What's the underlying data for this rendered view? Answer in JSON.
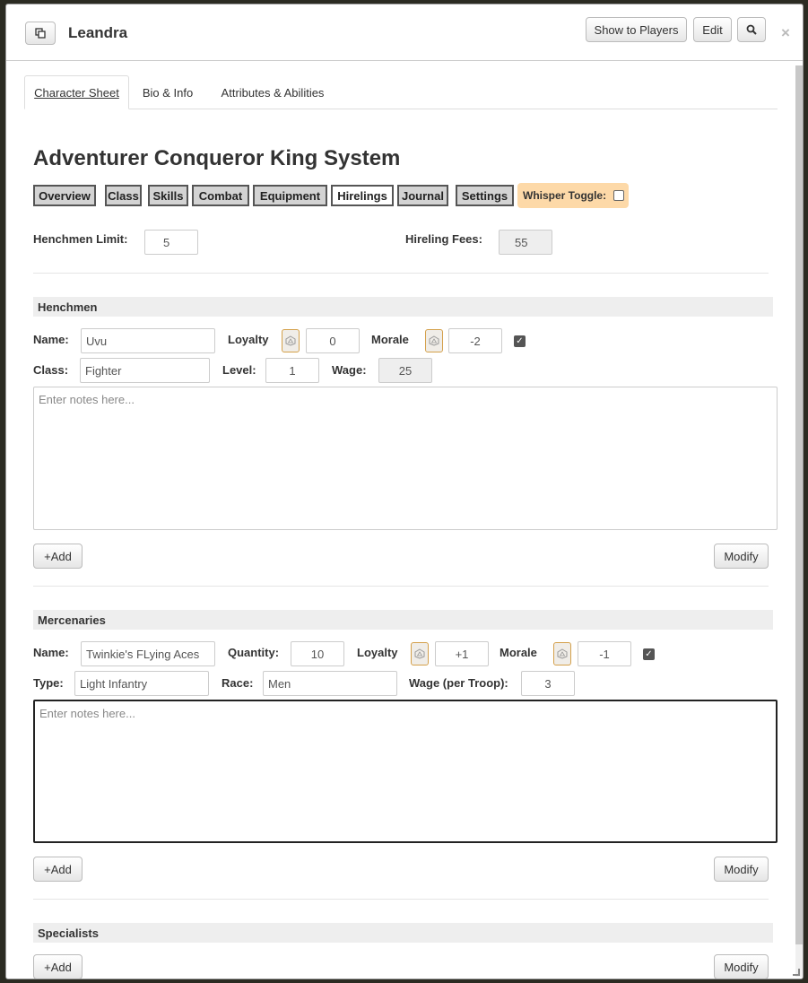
{
  "window": {
    "character_name": "Leandra",
    "show_to_players": "Show to Players",
    "edit": "Edit",
    "close": "×"
  },
  "tabs": [
    "Character Sheet",
    "Bio & Info",
    "Attributes & Abilities"
  ],
  "sheet_title": "Adventurer Conqueror King System",
  "nav": [
    "Overview",
    "Class",
    "Skills",
    "Combat",
    "Equipment",
    "Hirelings",
    "Journal",
    "Settings"
  ],
  "whisper_label": "Whisper Toggle:",
  "limits": {
    "henchmen_limit_label": "Henchmen Limit:",
    "henchmen_limit": "5",
    "hireling_fees_label": "Hireling Fees:",
    "hireling_fees": "55"
  },
  "henchmen": {
    "heading": "Henchmen",
    "name_label": "Name:",
    "name": "Uvu",
    "loyalty_label": "Loyalty",
    "loyalty": "0",
    "morale_label": "Morale",
    "morale": "-2",
    "class_label": "Class:",
    "class": "Fighter",
    "level_label": "Level:",
    "level": "1",
    "wage_label": "Wage:",
    "wage": "25",
    "notes_placeholder": "Enter notes here...",
    "add": "+Add",
    "modify": "Modify"
  },
  "mercenaries": {
    "heading": "Mercenaries",
    "name_label": "Name:",
    "name": "Twinkie's FLying Aces",
    "quantity_label": "Quantity:",
    "quantity": "10",
    "loyalty_label": "Loyalty",
    "loyalty": "+1",
    "morale_label": "Morale",
    "morale": "-1",
    "type_label": "Type:",
    "type": "Light Infantry",
    "race_label": "Race:",
    "race": "Men",
    "wage_label": "Wage (per Troop):",
    "wage": "3",
    "notes_placeholder": "Enter notes here...",
    "add": "+Add",
    "modify": "Modify"
  },
  "specialists": {
    "heading": "Specialists",
    "add": "+Add",
    "modify": "Modify"
  },
  "icons": {
    "popout": "popout-icon",
    "search": "search-icon",
    "dice": "d20-icon",
    "check": "checkmark-icon"
  },
  "colors": {
    "whisper_bg": "#fdd9a8",
    "dice_border": "#d4a04a"
  }
}
